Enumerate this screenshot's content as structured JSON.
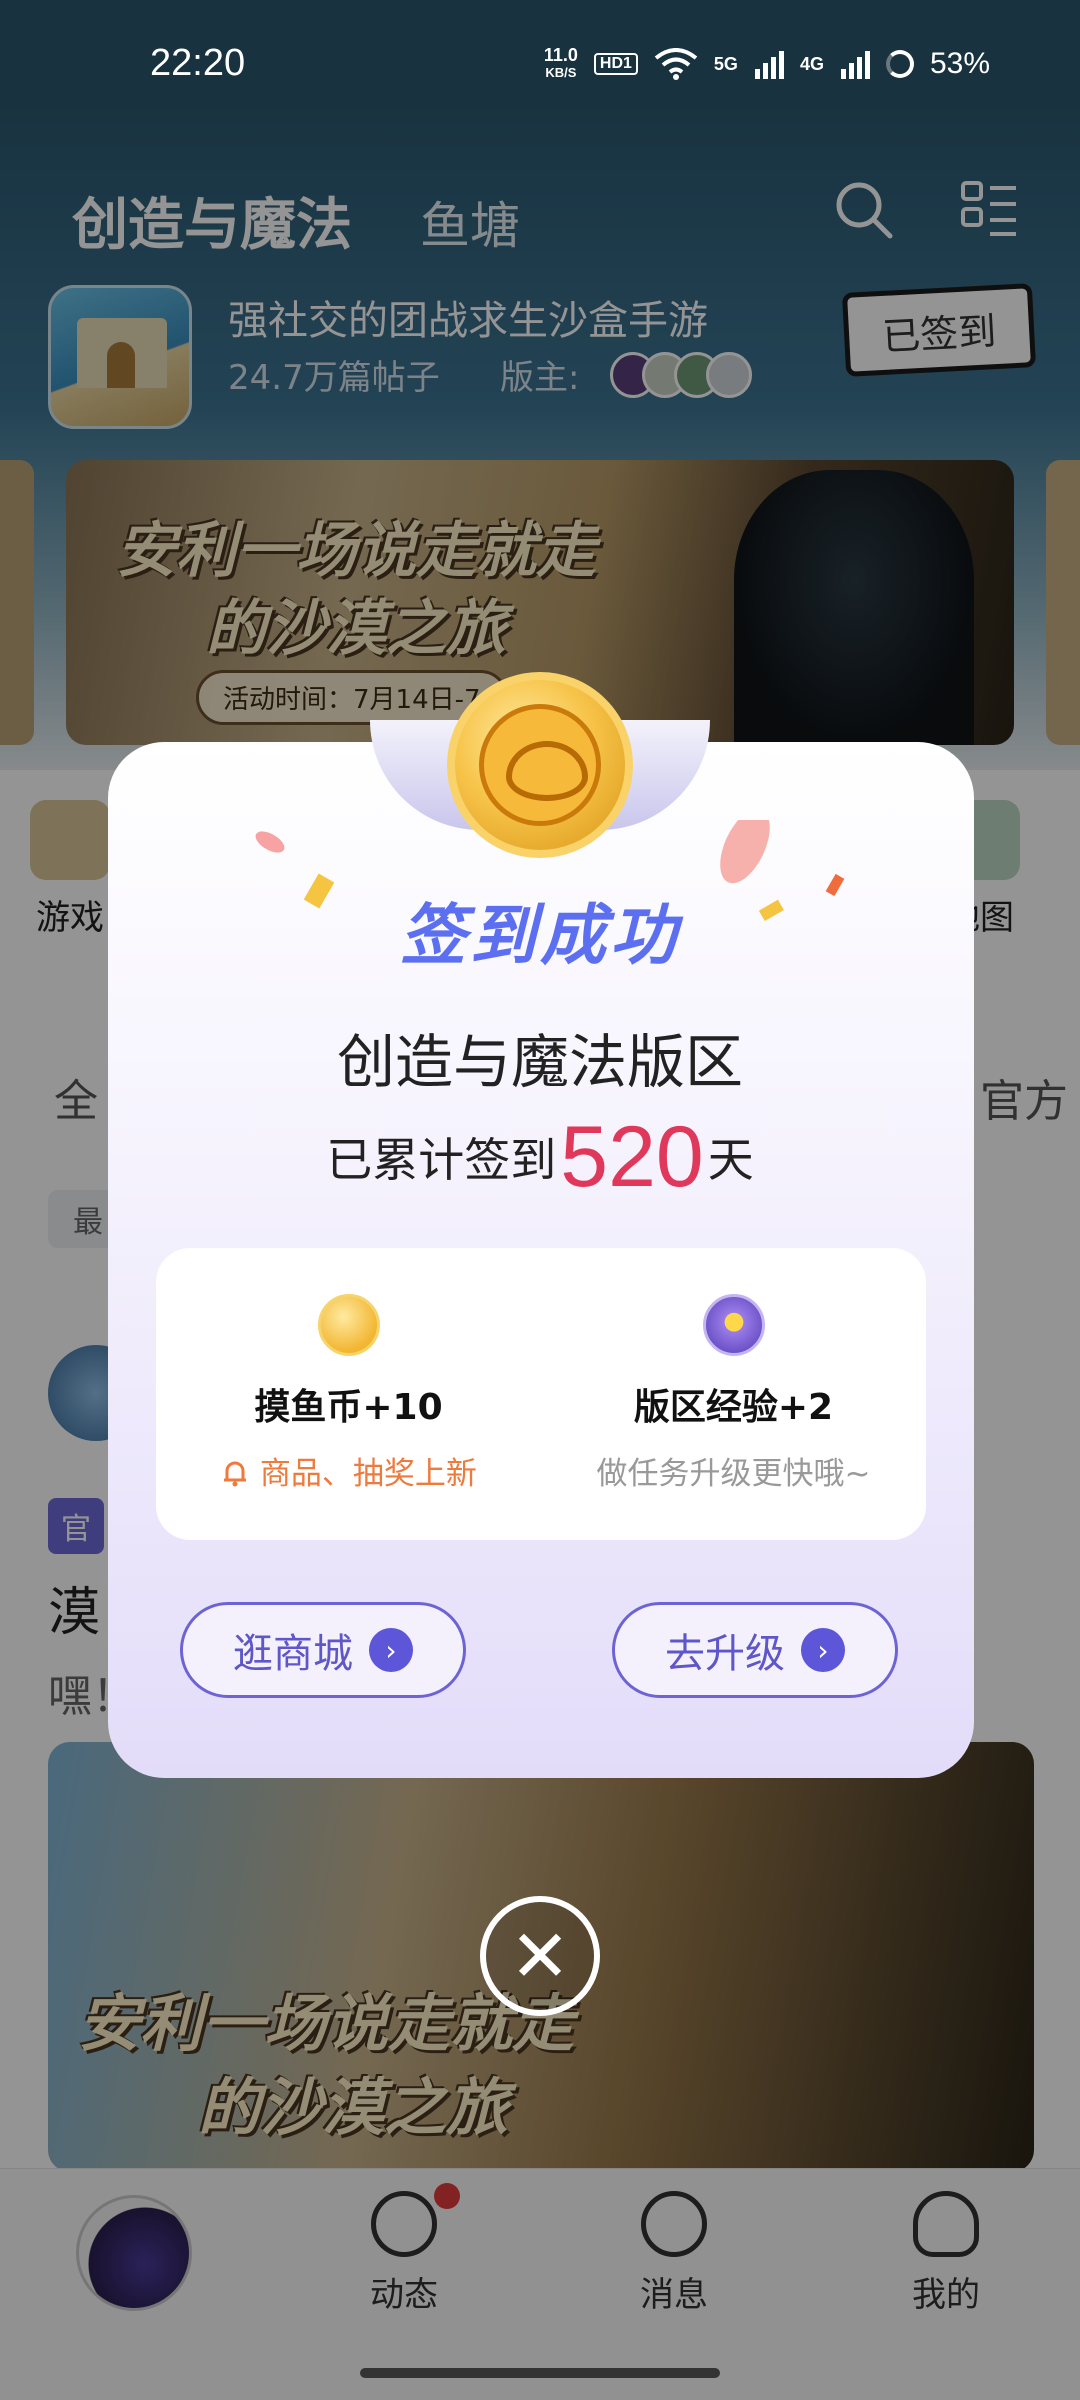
{
  "status_bar": {
    "time": "22:20",
    "net_speed_value": "11.0",
    "net_speed_unit": "KB/S",
    "hd_badge": "HD1",
    "signal_1": "5G",
    "signal_2": "4G",
    "battery": "53%"
  },
  "header": {
    "title": "创造与魔法",
    "tab2": "鱼塘",
    "search_icon": "search-icon",
    "menu_icon": "menu-grid-icon"
  },
  "forum": {
    "name": "强社交的团战求生沙盒手游",
    "posts": "24.7万篇帖子",
    "moderator_label": "版主:",
    "signed_label": "已签到"
  },
  "banner": {
    "title_line1": "安利一场说走就走",
    "title_line2": "的沙漠之旅",
    "time_label": "活动时间：7月14日-7"
  },
  "entries": {
    "left_label": "游戏",
    "right_label": "地图"
  },
  "tabs": {
    "left": "全",
    "right": "官方"
  },
  "chip": "最",
  "post": {
    "tag": "官",
    "title": "漠",
    "excerpt": "嘿！",
    "image_line1": "安利一场说走就走",
    "image_line2": "的沙漠之旅"
  },
  "bottom_nav": {
    "item2": "动态",
    "item3": "消息",
    "item4": "我的"
  },
  "modal": {
    "title": "签到成功",
    "forum_name": "创造与魔法版区",
    "streak_prefix": "已累计签到",
    "streak_days": "520",
    "streak_suffix": "天",
    "reward1_title": "摸鱼币+10",
    "reward1_sub": "商品、抽奖上新",
    "reward2_title": "版区经验+2",
    "reward2_sub": "做任务升级更快哦~",
    "btn_shop": "逛商城",
    "btn_upgrade": "去升级",
    "close": "✕"
  },
  "colors": {
    "accent": "#5e56d8",
    "streak_number": "#e0385a",
    "reward_note": "#ee7a3c"
  }
}
